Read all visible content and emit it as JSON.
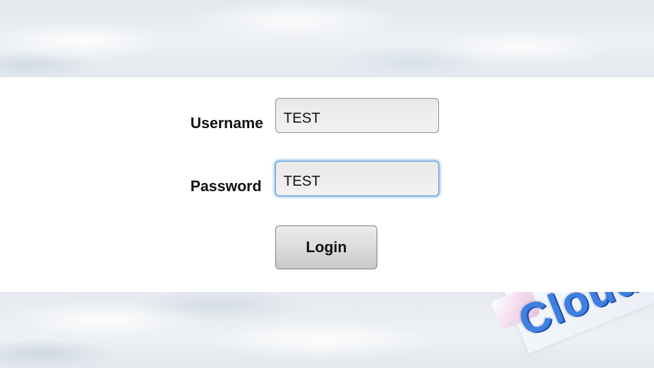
{
  "login_form": {
    "username_label": "Username",
    "username_value": "TEST",
    "password_label": "Password",
    "password_value": "TEST",
    "login_button_label": "Login"
  },
  "branding": {
    "logo_text": "Cloud"
  },
  "colors": {
    "panel_background": "#ffffff",
    "focus_ring": "#a9cdf2",
    "logo_blue": "#3f7fe0"
  }
}
